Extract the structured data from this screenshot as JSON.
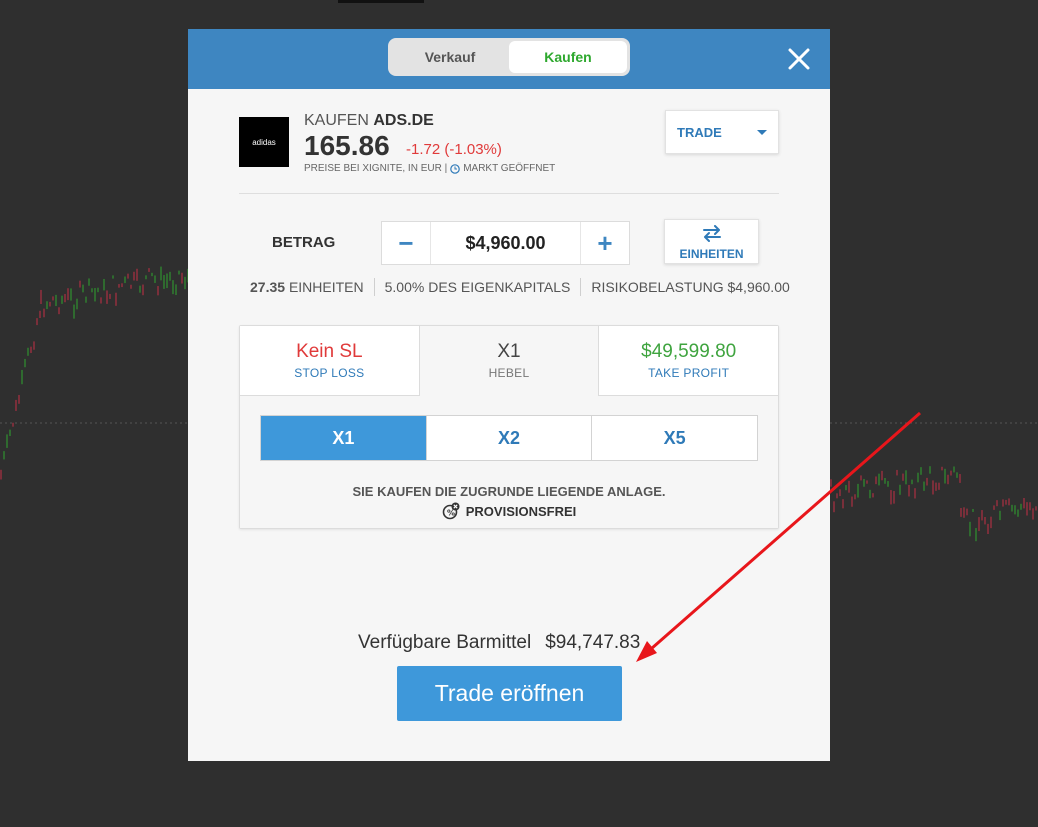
{
  "header": {
    "tab_sell": "Verkauf",
    "tab_buy": "Kaufen",
    "close_icon": "close-icon"
  },
  "asset": {
    "action": "KAUFEN",
    "symbol": "ADS.DE",
    "logo_text": "adidas",
    "price": "165.86",
    "change": "-1.72 (-1.03%)",
    "source": "PREISE BEI XIGNITE, IN EUR |",
    "market_status": "MARKT GEÖFFNET",
    "order_type": "TRADE"
  },
  "amount": {
    "label": "BETRAG",
    "value": "$4,960.00",
    "minus": "−",
    "plus": "+",
    "units_toggle": "EINHEITEN"
  },
  "stats": {
    "units_value": "27.35",
    "units_label": "EINHEITEN",
    "equity": "5.00% DES EIGENKAPITALS",
    "exposure": "RISIKOBELASTUNG $4,960.00"
  },
  "tabs": {
    "stop_loss_value": "Kein SL",
    "stop_loss_label": "STOP LOSS",
    "leverage_value": "X1",
    "leverage_label": "HEBEL",
    "take_profit_value": "$49,599.80",
    "take_profit_label": "TAKE PROFIT"
  },
  "leverage_options": [
    "X1",
    "X2",
    "X5"
  ],
  "notice": "SIE KAUFEN DIE ZUGRUNDE LIEGENDE ANLAGE.",
  "commission": "PROVISIONSFREI",
  "footer": {
    "balance_label": "Verfügbare Barmittel",
    "balance_value": "$94,747.83",
    "open_button": "Trade eröffnen"
  },
  "colors": {
    "header": "#3e86c1",
    "active_blue": "#3e98da",
    "buy_green": "#2ea82e",
    "loss_red": "#e03a3a",
    "arrow_red": "#e8161b"
  }
}
